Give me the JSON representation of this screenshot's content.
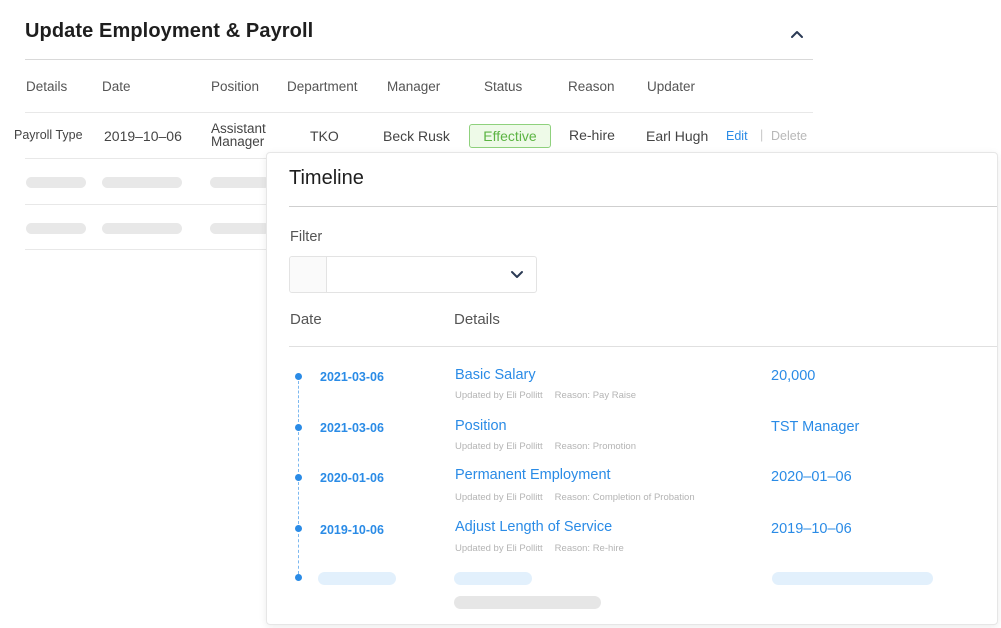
{
  "section": {
    "title": "Update Employment & Payroll"
  },
  "table": {
    "headers": [
      "Details",
      "Date",
      "Position",
      "Department",
      "Manager",
      "Status",
      "Reason",
      "Updater"
    ],
    "row": {
      "details": "Payroll Type",
      "date": "2019–10–06",
      "position_line1": "Assistant",
      "position_line2": "Manager",
      "department": "TKO",
      "manager": "Beck Rusk",
      "status": "Effective",
      "reason": "Re-hire",
      "updater": "Earl Hugh",
      "edit": "Edit",
      "separator": "|",
      "delete": "Delete"
    }
  },
  "timeline": {
    "title": "Timeline",
    "filter_label": "Filter",
    "filter_value": "",
    "col_date": "Date",
    "col_details": "Details",
    "items": [
      {
        "date": "2021-03-06",
        "title": "Basic Salary",
        "updated_by": "Updated by Eli Pollitt",
        "reason": "Reason: Pay Raise",
        "value": "20,000"
      },
      {
        "date": "2021-03-06",
        "title": "Position",
        "updated_by": "Updated by Eli Pollitt",
        "reason": "Reason: Promotion",
        "value": "TST Manager"
      },
      {
        "date": "2020-01-06",
        "title": "Permanent Employment",
        "updated_by": "Updated by Eli Pollitt",
        "reason": "Reason: Completion of Probation",
        "value": "2020–01–06"
      },
      {
        "date": "2019-10-06",
        "title": "Adjust Length of Service",
        "updated_by": "Updated by Eli Pollitt",
        "reason": "Reason: Re-hire",
        "value": "2019–10–06"
      }
    ]
  },
  "colors": {
    "accent": "#2a8be6",
    "status_green": "#5cb443"
  },
  "icons": {
    "collapse": "chevron-up-icon",
    "filter_dropdown": "chevron-down-icon"
  }
}
